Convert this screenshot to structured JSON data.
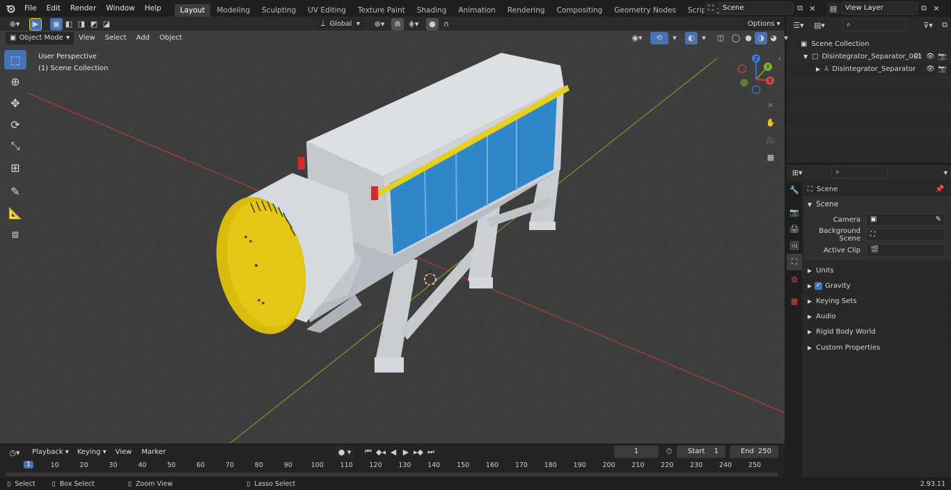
{
  "app": {
    "version": "2.93.11"
  },
  "menus": [
    "File",
    "Edit",
    "Render",
    "Window",
    "Help"
  ],
  "workspaces": {
    "active": "Layout",
    "tabs": [
      "Layout",
      "Modeling",
      "Sculpting",
      "UV Editing",
      "Texture Paint",
      "Shading",
      "Animation",
      "Rendering",
      "Compositing",
      "Geometry Nodes",
      "Scripting"
    ]
  },
  "scene_field": "Scene",
  "view_layer_field": "View Layer",
  "viewport_header": {
    "mode": "Object Mode",
    "menus": [
      "View",
      "Select",
      "Add",
      "Object"
    ],
    "transform": "Global",
    "options": "Options"
  },
  "viewport": {
    "perspective": "User Perspective",
    "collection": "(1) Scene Collection"
  },
  "gizmo": {
    "x": "X",
    "y": "Y",
    "z": "Z"
  },
  "outliner": {
    "root": "Scene Collection",
    "items": [
      {
        "label": "Disintegrator_Separator_001",
        "level": 1
      },
      {
        "label": "Disintegrator_Separator",
        "level": 2
      }
    ]
  },
  "properties": {
    "header": "Scene",
    "panel": "Scene",
    "camera_label": "Camera",
    "bg_scene_label": "Background Scene",
    "active_clip_label": "Active Clip",
    "sections": [
      "Units",
      "Gravity",
      "Keying Sets",
      "Audio",
      "Rigid Body World",
      "Custom Properties"
    ],
    "gravity_checked": true
  },
  "timeline": {
    "menus": [
      "Playback",
      "Keying",
      "View",
      "Marker"
    ],
    "current_frame": "1",
    "start_label": "Start",
    "start_value": "1",
    "end_label": "End",
    "end_value": "250",
    "ticks": [
      "1",
      "10",
      "20",
      "30",
      "40",
      "50",
      "60",
      "70",
      "80",
      "90",
      "100",
      "110",
      "120",
      "130",
      "140",
      "150",
      "160",
      "170",
      "180",
      "190",
      "200",
      "210",
      "220",
      "230",
      "240",
      "250"
    ]
  },
  "status": {
    "select": "Select",
    "box_select": "Box Select",
    "zoom": "Zoom View",
    "lasso": "Lasso Select"
  }
}
